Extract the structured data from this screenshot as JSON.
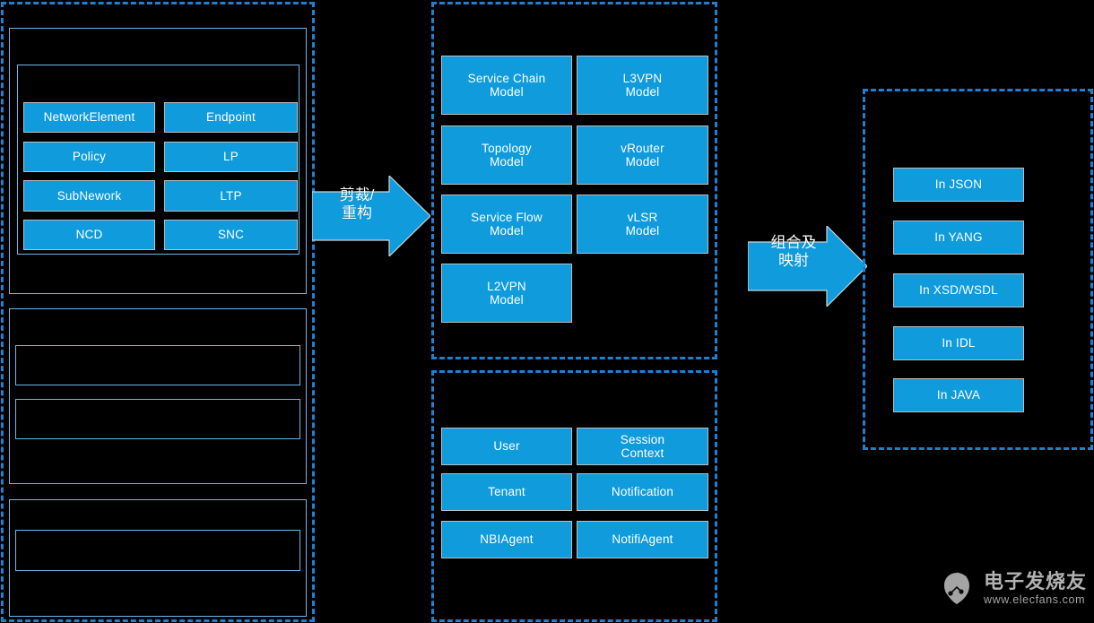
{
  "diagram": {
    "accent_blue": "#0f9bdc",
    "dash_blue": "#1f7fd0",
    "frame_blue": "#6cb8e8",
    "background": "#000000",
    "chip_border": "#bcbec0"
  },
  "left_group": {
    "section_1": {
      "chips": [
        {
          "label": "NetworkElement"
        },
        {
          "label": "Endpoint"
        },
        {
          "label": "Policy"
        },
        {
          "label": "LP"
        },
        {
          "label": "SubNework"
        },
        {
          "label": "LTP"
        },
        {
          "label": "NCD"
        },
        {
          "label": "SNC"
        }
      ]
    },
    "section_2": {
      "inner_boxes": [
        "",
        ""
      ]
    },
    "section_3": {
      "inner_boxes": [
        ""
      ]
    }
  },
  "middle_group_top": {
    "chips": [
      {
        "label": "Service Chain\nModel"
      },
      {
        "label": "L3VPN\nModel"
      },
      {
        "label": "Topology\nModel"
      },
      {
        "label": "vRouter\nModel"
      },
      {
        "label": "Service Flow\nModel"
      },
      {
        "label": "vLSR\nModel"
      },
      {
        "label": "L2VPN\nModel"
      }
    ]
  },
  "middle_group_bottom": {
    "chips": [
      {
        "label": "User"
      },
      {
        "label": "Session\nContext"
      },
      {
        "label": "Tenant"
      },
      {
        "label": "Notification"
      },
      {
        "label": "NBIAgent"
      },
      {
        "label": "NotifiAgent"
      }
    ]
  },
  "right_group": {
    "chips": [
      {
        "label": "In JSON"
      },
      {
        "label": "In YANG"
      },
      {
        "label": "In XSD/WSDL"
      },
      {
        "label": "In IDL"
      },
      {
        "label": "In JAVA"
      }
    ]
  },
  "arrows": [
    {
      "label": "剪裁/\n重构",
      "name": "arrow-trim-restructure"
    },
    {
      "label": "组合及\n映射",
      "name": "arrow-compose-map"
    }
  ],
  "watermark": {
    "brand_cn": "电子发烧友",
    "url": "www.elecfans.com"
  }
}
